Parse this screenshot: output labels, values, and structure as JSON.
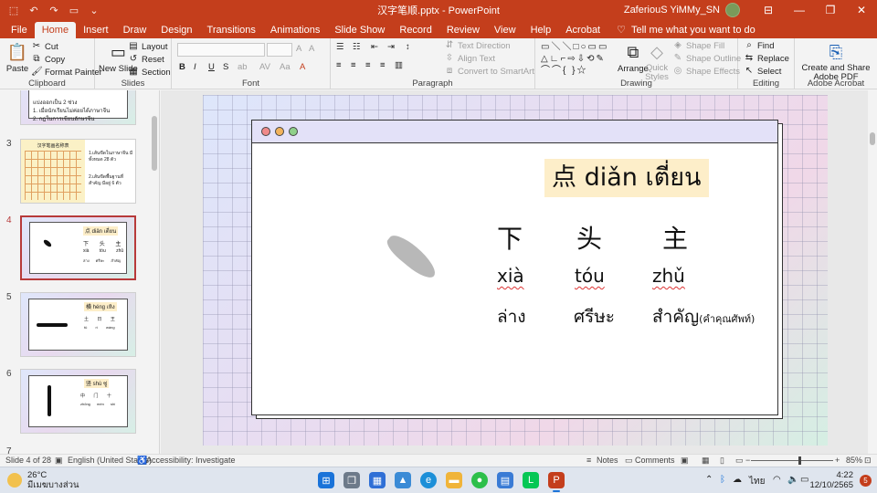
{
  "window": {
    "title": "汉字笔顺.pptx  -  PowerPoint",
    "user": "ZaferiouS YiMMy_SN",
    "minimize": "—",
    "restore": "❐",
    "close": "✕",
    "ribbon_options": "⊟"
  },
  "menu": {
    "tabs": [
      "File",
      "Home",
      "Insert",
      "Draw",
      "Design",
      "Transitions",
      "Animations",
      "Slide Show",
      "Record",
      "Review",
      "View",
      "Help",
      "Acrobat"
    ],
    "active_tab": "Home",
    "tell_me": "Tell me what you want to do"
  },
  "ribbon": {
    "clipboard": {
      "paste": "Paste",
      "cut": "Cut",
      "copy": "Copy",
      "format_painter": "Format Painter",
      "label": "Clipboard"
    },
    "slides": {
      "new_slide": "New Slide",
      "layout": "Layout",
      "reset": "Reset",
      "section": "Section",
      "label": "Slides"
    },
    "font": {
      "label": "Font",
      "bold": "B",
      "italic": "I",
      "underline": "U",
      "strike": "S",
      "shadow": "ab"
    },
    "paragraph": {
      "label": "Paragraph",
      "text_direction": "Text Direction",
      "align_text": "Align Text",
      "convert_smartart": "Convert to SmartArt"
    },
    "drawing": {
      "label": "Drawing",
      "arrange": "Arrange",
      "quick_styles": "Quick Styles",
      "shape_fill": "Shape Fill",
      "shape_outline": "Shape Outline",
      "shape_effects": "Shape Effects"
    },
    "editing": {
      "label": "Editing",
      "find": "Find",
      "replace": "Replace",
      "select": "Select"
    },
    "acrobat": {
      "label": "Adobe Acrobat",
      "create_share": "Create and Share Adobe PDF"
    }
  },
  "thumbnails": {
    "partial_top": [
      "แบ่งออกเป็น 2 ช่วง",
      "1.  เมื่อนักเรียนไม่ค่อยได้ภาษาจีน",
      "2.  กฎในการเขียนอักษรจีน"
    ],
    "slides": [
      {
        "num": "3",
        "title": "汉字笔画名称表",
        "text1": "1.เส้นขีดในภาษาจีน มีทั้งหมด 28 ตัว",
        "text2": "2.เส้นขีดพื้นฐานที่สำคัญ มีอยู่ 6 ตัว"
      },
      {
        "num": "4",
        "title": "点 diǎn เตี่ยน",
        "chars": [
          "下",
          "头",
          "主"
        ],
        "pinyin": [
          "xià",
          "tóu",
          "zhǔ"
        ],
        "thai": [
          "ล่าง",
          "ศรีษะ",
          "สำคัญ"
        ]
      },
      {
        "num": "5",
        "title": "横 héng เหิง",
        "chars": [
          "土",
          "日",
          "王"
        ],
        "pinyin": [
          "tǔ",
          "rì",
          "wáng"
        ]
      },
      {
        "num": "6",
        "title": "竖 shù ซู่",
        "chars": [
          "中",
          "门",
          "十"
        ],
        "pinyin": [
          "zhōng",
          "mén",
          "shí"
        ]
      },
      {
        "num": "7"
      }
    ]
  },
  "slide": {
    "heading": "点 diǎn เตี่ยน",
    "words": [
      {
        "hanzi": "下",
        "pinyin": "xià",
        "thai": "ล่าง",
        "note": ""
      },
      {
        "hanzi": "头",
        "pinyin": "tóu",
        "thai": "ศรีษะ",
        "note": ""
      },
      {
        "hanzi": "主",
        "pinyin": "zhǔ",
        "thai": "สำคัญ",
        "note": "(คำคุณศัพท์)"
      }
    ],
    "dot_colors": [
      "#f08a8a",
      "#f2b35c",
      "#8fd08a"
    ]
  },
  "status": {
    "slide_of": "Slide 4 of 28",
    "language": "English (United States)",
    "accessibility": "Accessibility: Investigate",
    "notes": "Notes",
    "comments": "Comments",
    "zoom": "85%"
  },
  "taskbar": {
    "temp": "26°C",
    "weather": "มีเมฆบางส่วน",
    "lang": "ไทย",
    "time": "4:22",
    "date": "12/10/2565",
    "notification_count": "5"
  },
  "colors": {
    "accent": "#c43e1c",
    "selected_border": "#b73a3a",
    "heading_bg": "#fdeec9",
    "window_bar": "#e3e1f8"
  }
}
